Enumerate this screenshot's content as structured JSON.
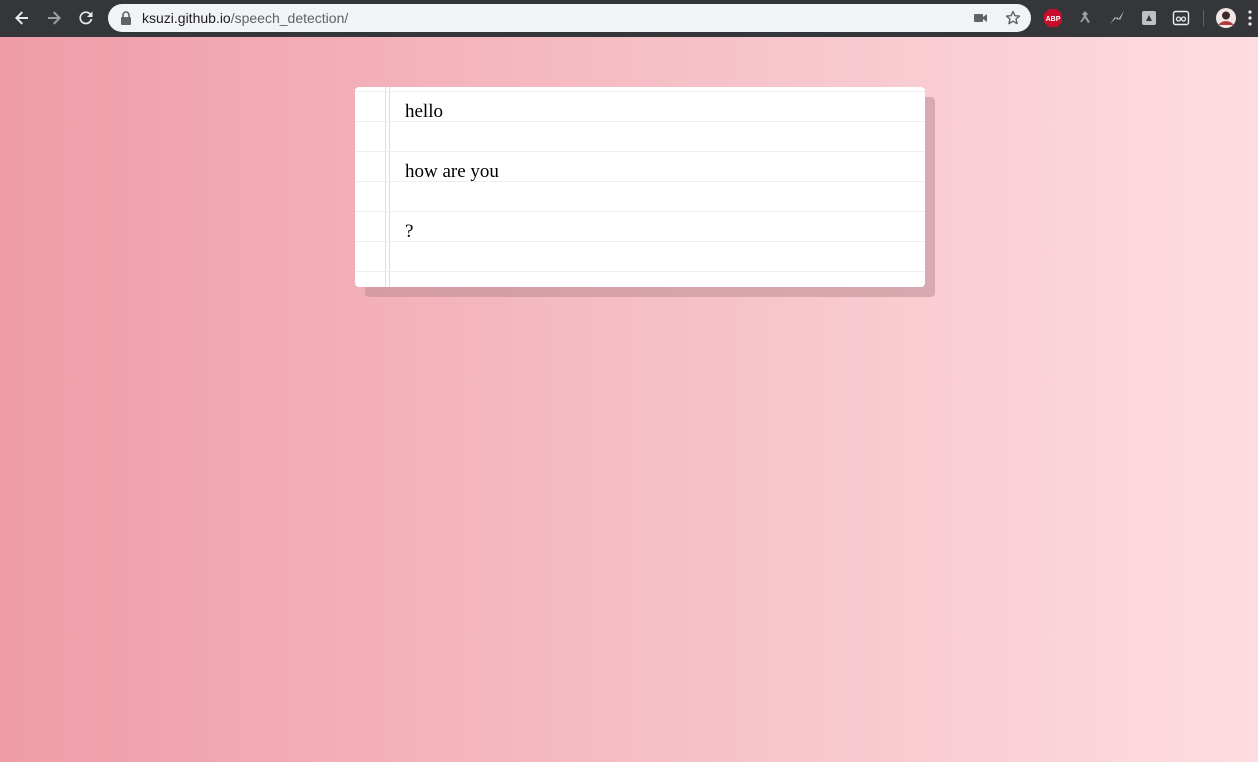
{
  "browser": {
    "url_host": "ksuzi.github.io",
    "url_path": "/speech_detection/",
    "nav": {
      "back": "back-arrow-icon",
      "forward": "forward-arrow-icon",
      "reload": "reload-icon"
    },
    "omnibox_icons": [
      "lock-icon",
      "camera-icon",
      "star-icon"
    ],
    "extensions": [
      {
        "name": "adblock-plus-icon",
        "label": "ABP",
        "color": "#c70d2c"
      },
      {
        "name": "extension-figure-icon"
      },
      {
        "name": "extension-lightning-icon"
      },
      {
        "name": "extension-puzzle-icon"
      },
      {
        "name": "extension-glasses-icon"
      },
      {
        "name": "profile-avatar-icon"
      },
      {
        "name": "menu-kebab-icon"
      }
    ]
  },
  "page": {
    "paragraphs": [
      "hello",
      "how are you",
      "?"
    ]
  },
  "colors": {
    "toolbar": "#35363a",
    "gradient_left": "#ef9ca6",
    "gradient_right": "#fddde1",
    "paper": "#ffffff"
  }
}
